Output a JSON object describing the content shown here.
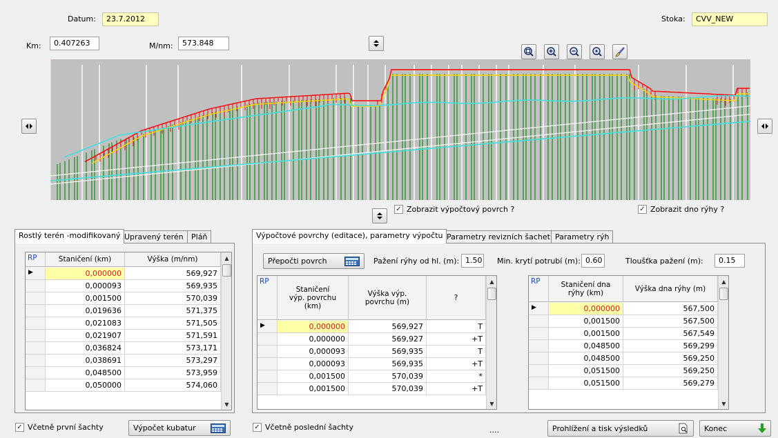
{
  "header": {
    "datum_label": "Datum:",
    "datum_value": "23.7.2012",
    "stoka_label": "Stoka:",
    "stoka_value": "CVV_NEW",
    "km_label": "Km:",
    "km_value": "0.407263",
    "mnm_label": "M/nm:",
    "mnm_value": "573.848"
  },
  "icons": {
    "up": "arrow-up-icon",
    "down": "arrow-down-icon",
    "left": "arrow-left-icon",
    "right": "arrow-right-icon",
    "zoom_fit": "zoom-fit-icon",
    "zoom_in": "zoom-in-icon",
    "zoom_out": "zoom-out-icon",
    "zoom_area": "zoom-area-icon",
    "paint": "paint-brush-icon",
    "calculator": "calculator-icon",
    "preview": "print-preview-icon",
    "exit": "green-down-arrow-icon"
  },
  "colors": {
    "profile_bg": "#c0c0c0",
    "terrain": "#ff0000",
    "surface": "#ffd700",
    "pipe": "#40e0e0",
    "stations": "#138a13"
  },
  "checks": {
    "show_surface": "Zobrazit výpočtový povrch ?",
    "show_trench": "Zobrazit dno rýhy ?",
    "first_shaft": "Včetně první šachty",
    "last_shaft": "Včetně poslední šachty"
  },
  "left_tabs": [
    "Rostlý terén -modifikovaný",
    "Upravený terén",
    "Pláň"
  ],
  "left_grid": {
    "headers": [
      "RP",
      "Staničení (km)",
      "Výška (m/nm)"
    ],
    "rows": [
      [
        "0,000000",
        "569,927"
      ],
      [
        "0,000093",
        "569,935"
      ],
      [
        "0,001500",
        "570,039"
      ],
      [
        "0,019636",
        "571,375"
      ],
      [
        "0,021083",
        "571,505"
      ],
      [
        "0,021907",
        "571,591"
      ],
      [
        "0,036824",
        "573,171"
      ],
      [
        "0,038691",
        "573,297"
      ],
      [
        "0,048500",
        "573,959"
      ],
      [
        "0,050000",
        "574,060"
      ]
    ]
  },
  "right_tabs": [
    "Výpočtové povrchy (editace), parametry výpočtu",
    "Parametry revizních šachet",
    "Parametry rýh"
  ],
  "params": {
    "recalc_button": "Přepočti povrch",
    "pazeni_label": "Pažení rýhy od hl. (m):",
    "pazeni_value": "1.50",
    "kryti_label": "Min. krytí potrubí (m):",
    "kryti_value": "0.60",
    "tloustka_label": "Tloušťka pažení (m):",
    "tloustka_value": "0.15"
  },
  "surface_grid": {
    "headers": [
      "RP",
      "Staničení výp. povrchu (km)",
      "Výška výp. povrchu (m)",
      "?"
    ],
    "rows": [
      [
        "0,000000",
        "569,927",
        "T"
      ],
      [
        "0,000000",
        "569,927",
        "+T"
      ],
      [
        "0,000093",
        "569,935",
        "T"
      ],
      [
        "0,000093",
        "569,935",
        "+T"
      ],
      [
        "0,001500",
        "570,039",
        "*"
      ],
      [
        "0,001500",
        "570,039",
        "+T"
      ]
    ]
  },
  "trench_grid": {
    "headers": [
      "RP",
      "Staničení dna rýhy (km)",
      "Výška dna rýhy (m)"
    ],
    "rows": [
      [
        "0,000000",
        "567,500"
      ],
      [
        "0,001500",
        "567,500"
      ],
      [
        "0,001500",
        "567,549"
      ],
      [
        "0,048500",
        "569,299"
      ],
      [
        "0,048500",
        "569,250"
      ],
      [
        "0,051500",
        "569,250"
      ],
      [
        "0,051500",
        "569,279"
      ]
    ]
  },
  "footer": {
    "kubatur_button": "Výpočet kubatur",
    "dots": "....",
    "print_button": "Prohlížení a tisk výsledků",
    "exit_button": "Konec"
  }
}
